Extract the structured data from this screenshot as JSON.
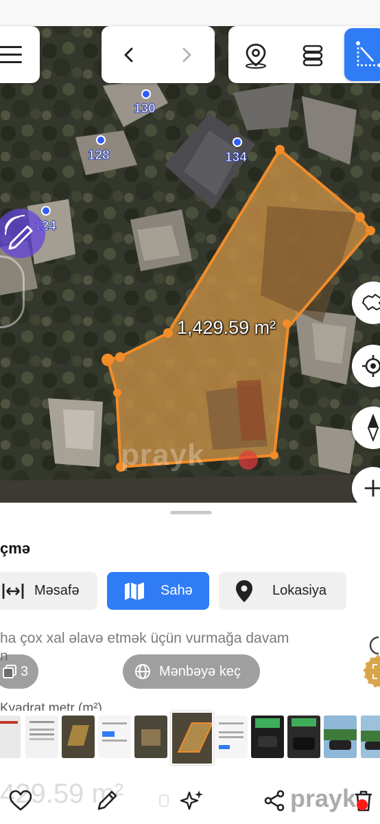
{
  "map": {
    "parcel_pins": [
      {
        "label": "130"
      },
      {
        "label": "128"
      },
      {
        "label": "134"
      },
      {
        "label": "124"
      }
    ],
    "area_readout": "1,429.59 m²",
    "watermark": "prayk",
    "toolbar_icons": [
      "menu-icon",
      "back-chevron-icon",
      "forward-chevron-icon",
      "location-pin-icon",
      "layers-icon",
      "measure-tool-icon"
    ],
    "side_icons": [
      "azerbaijan-map-icon",
      "crosshair-icon",
      "compass-icon",
      "zoom-in-icon"
    ],
    "accent_color": "#2f7cf6",
    "polygon_color": "#f28c28"
  },
  "sheet": {
    "title": "çmə",
    "modes": [
      {
        "label": "Məsafə",
        "icon": "ruler-icon",
        "active": false
      },
      {
        "label": "Sahə",
        "icon": "map-icon",
        "active": true
      },
      {
        "label": "Lokasiya",
        "icon": "location-pin-icon",
        "active": false
      }
    ],
    "hint_line1": "ha çox xal əlavə etmək üçün vurmağa davam",
    "hint_line2": "n",
    "photo_count": "3",
    "source_button": "Mənbəyə keç",
    "unit_label": "Kvadrat metr (m²)",
    "big_value": "429.59 m²",
    "brand": "prayk",
    "actions": [
      "heart-icon",
      "pencil-icon",
      "sparkle-icon",
      "share-icon",
      "trash-icon"
    ]
  }
}
